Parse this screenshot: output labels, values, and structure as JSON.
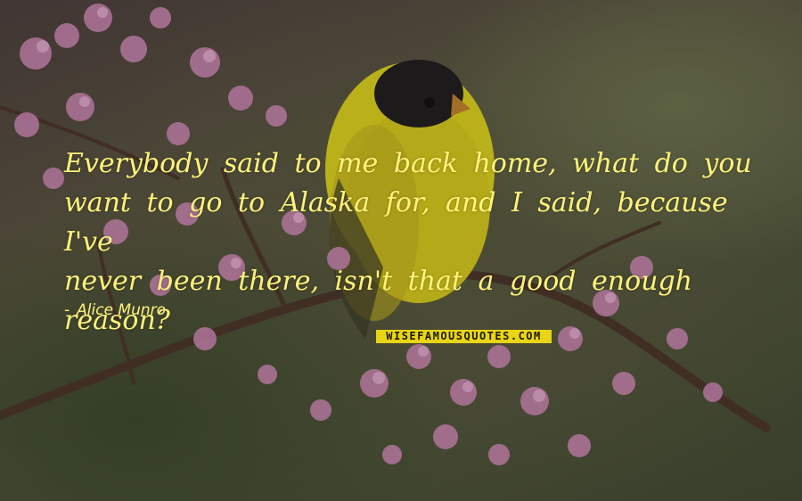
{
  "quote": {
    "lines": [
      "Everybody said to me back home, what do you",
      "want to go to Alaska for, and I said, because I've",
      "never been there, isn't that a good enough",
      "reason?"
    ],
    "author_dash": "-",
    "author": "Alice Munro"
  },
  "brand": {
    "label": "WISEFAMOUSQUOTES.COM"
  },
  "colors": {
    "text": "#fff37a",
    "brand_bg": "#e9d515",
    "bird_body": "#e9e21f",
    "bird_cap": "#1c1c1c",
    "blossom": "#d98fc0"
  },
  "background": {
    "subject": "yellow goldfinch on branch with pink blossoms"
  }
}
